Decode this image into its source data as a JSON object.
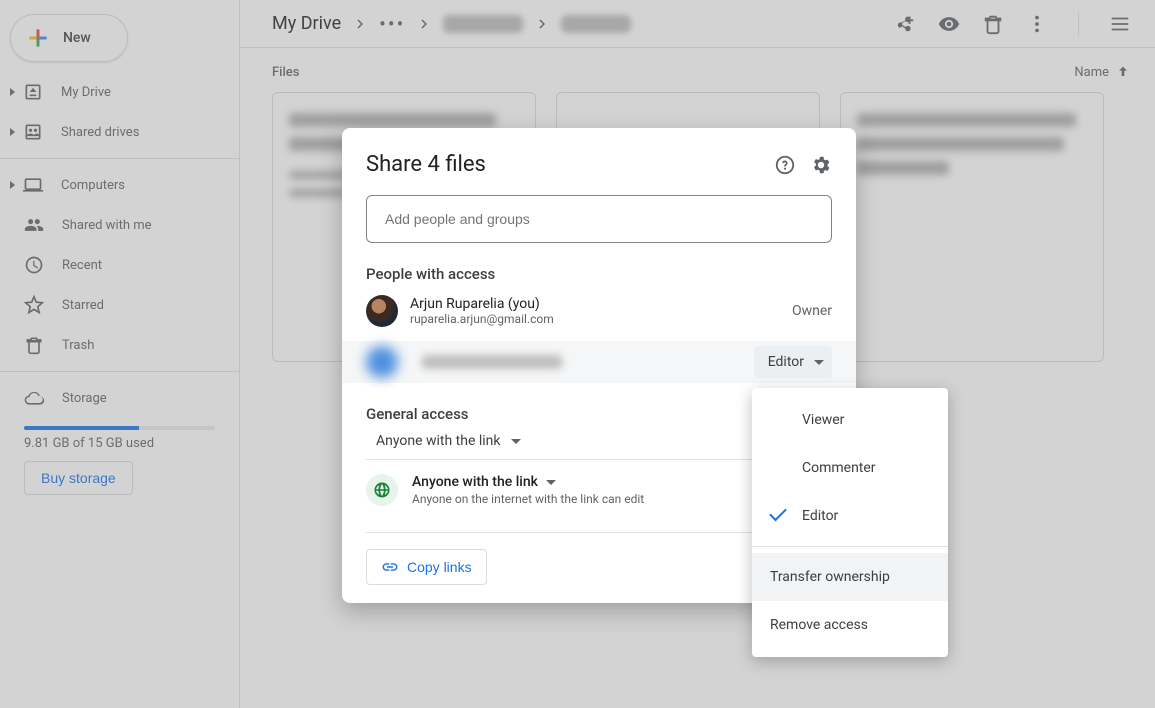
{
  "sidebar": {
    "new_label": "New",
    "items": [
      {
        "label": "My Drive"
      },
      {
        "label": "Shared drives"
      },
      {
        "label": "Computers"
      },
      {
        "label": "Shared with me"
      },
      {
        "label": "Recent"
      },
      {
        "label": "Starred"
      },
      {
        "label": "Trash"
      },
      {
        "label": "Storage"
      }
    ],
    "storage_text": "9.81 GB of 15 GB used",
    "buy_label": "Buy storage"
  },
  "topbar": {
    "root": "My Drive",
    "actions": [
      "share",
      "preview",
      "trash",
      "more",
      "layout"
    ]
  },
  "subheader": {
    "left": "Files",
    "sort": "Name"
  },
  "dialog": {
    "title": "Share 4 files",
    "add_placeholder": "Add people and groups",
    "section_people": "People with access",
    "owner": {
      "name": "Arjun Ruparelia (you)",
      "email": "ruparelia.arjun@gmail.com",
      "role": "Owner"
    },
    "editor_role_label": "Editor",
    "section_general": "General access",
    "ga_select": "Anyone with the link",
    "ga_detail_title": "Anyone with the link",
    "ga_detail_sub": "Anyone on the internet with the link can edit",
    "copy_label": "Copy links"
  },
  "menu": {
    "viewer": "Viewer",
    "commenter": "Commenter",
    "editor": "Editor",
    "transfer": "Transfer ownership",
    "remove": "Remove access"
  }
}
